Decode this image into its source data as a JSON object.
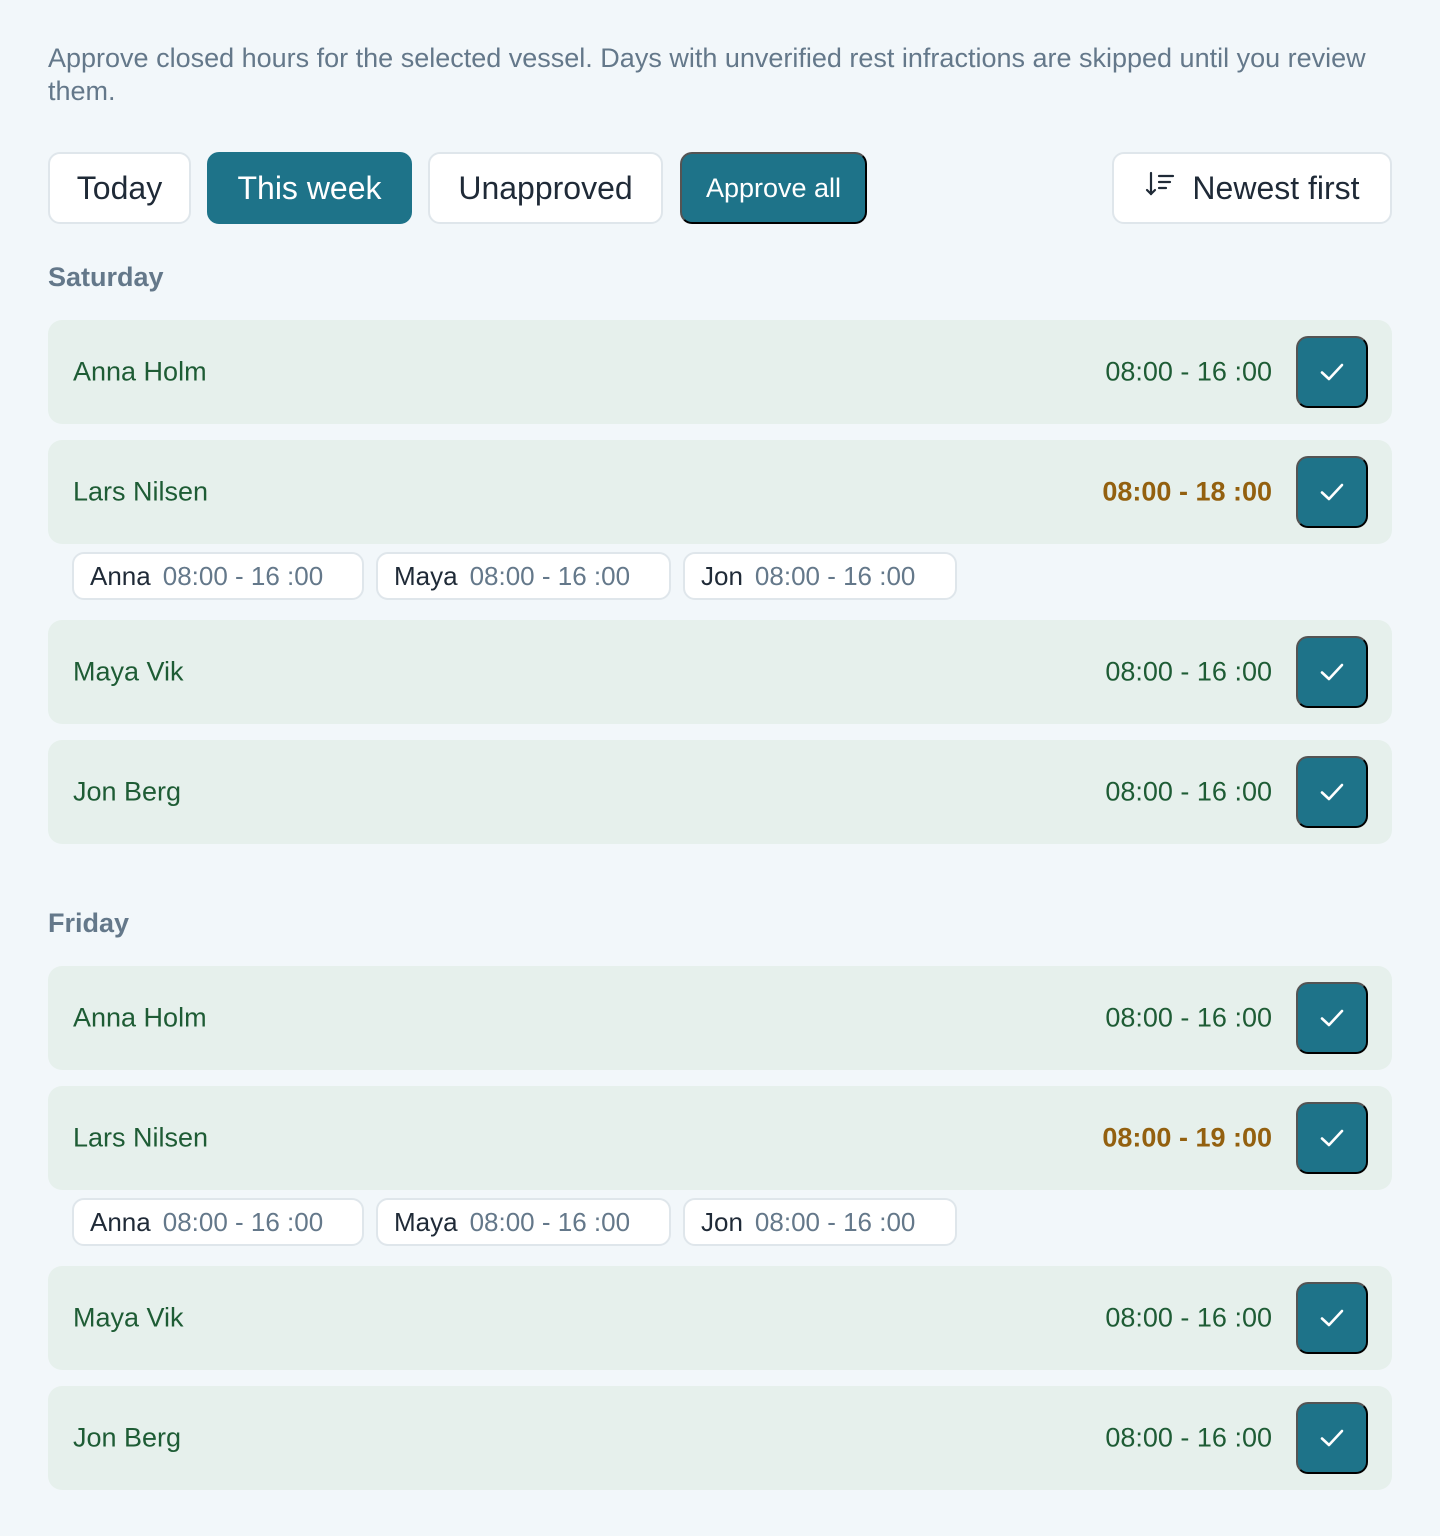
{
  "intro": "Approve closed hours for the selected vessel. Days with unverified rest infractions are skipped until you review them.",
  "filters": {
    "today": "Today",
    "this_week": "This week",
    "unapproved": "Unapproved",
    "active": "This week"
  },
  "approve_all": "Approve all",
  "sort": {
    "label": "Newest first",
    "icon": "sort-descending-icon"
  },
  "colors": {
    "accent": "#1e7389",
    "row_bg": "#e6f0ec",
    "name_text": "#1e5c35",
    "warning_text": "#93600f",
    "muted_text": "#64788a"
  },
  "days": [
    {
      "label": "Saturday",
      "rows": [
        {
          "name": "Anna Holm",
          "hours": "08:00 -  16 :00"
        },
        {
          "name": "Lars Nilsen",
          "hours": "08:00 -  18 :00",
          "warning": true,
          "chips": [
            {
              "name": "Anna",
              "hours": "08:00 -  16 :00"
            },
            {
              "name": "Maya",
              "hours": "08:00 -  16 :00"
            },
            {
              "name": "Jon",
              "hours": "08:00 -  16 :00"
            }
          ]
        },
        {
          "name": "Maya Vik",
          "hours": "08:00 -  16 :00"
        },
        {
          "name": "Jon Berg",
          "hours": "08:00 -  16 :00"
        }
      ]
    },
    {
      "label": "Friday",
      "rows": [
        {
          "name": "Anna Holm",
          "hours": "08:00 -  16 :00"
        },
        {
          "name": "Lars Nilsen",
          "hours": "08:00 -  19 :00",
          "warning": true,
          "chips": [
            {
              "name": "Anna",
              "hours": "08:00 -  16 :00"
            },
            {
              "name": "Maya",
              "hours": "08:00 -  16 :00"
            },
            {
              "name": "Jon",
              "hours": "08:00 -  16 :00"
            }
          ]
        },
        {
          "name": "Maya Vik",
          "hours": "08:00 -  16 :00"
        },
        {
          "name": "Jon Berg",
          "hours": "08:00 -  16 :00"
        }
      ]
    }
  ]
}
